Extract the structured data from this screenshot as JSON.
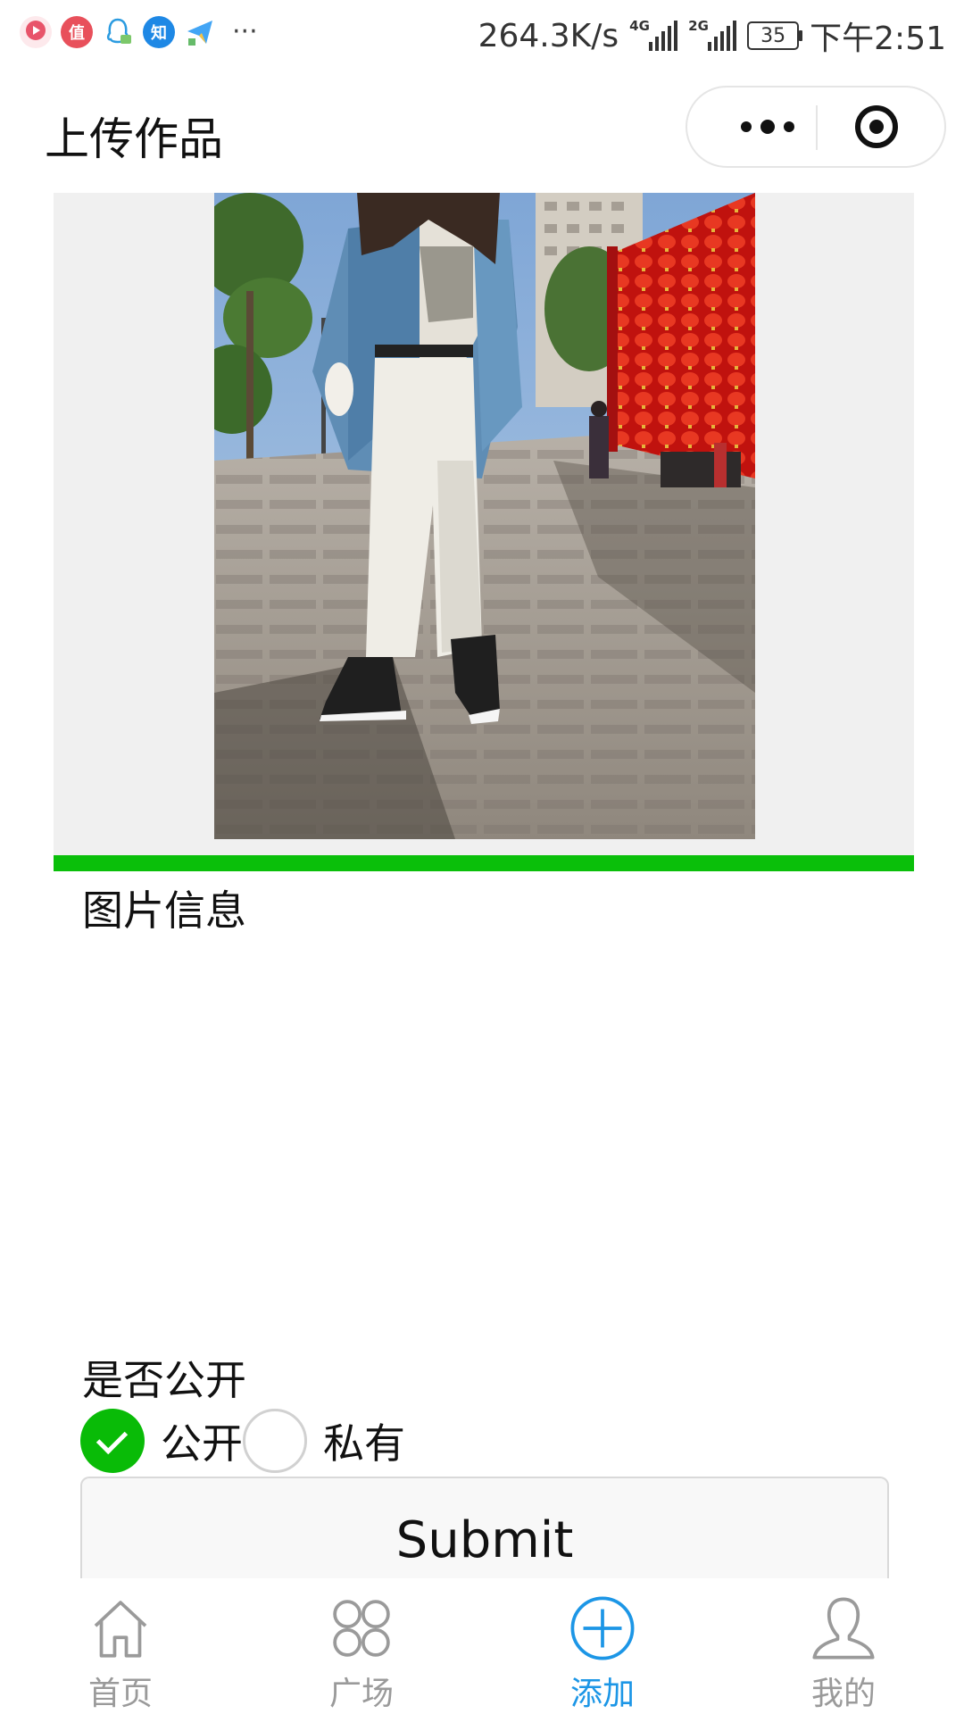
{
  "status_bar": {
    "net_speed": "264.3K/s",
    "signal1_tag": "4G",
    "signal2_tag": "2G",
    "battery": "35",
    "time": "下午2:51",
    "app_icons": [
      "video-app-icon",
      "zhi-app-icon",
      "qq-app-icon",
      "zhihu-icon",
      "send-app-icon"
    ],
    "zhihu_label": "知",
    "zhi_label": "值",
    "more": "···"
  },
  "nav": {
    "title": "上传作品"
  },
  "upload": {
    "progress": 1.0,
    "progress_color": "#0abf0a",
    "info_label": "图片信息",
    "public_label": "是否公开",
    "options": [
      {
        "label": "公开",
        "checked": true
      },
      {
        "label": "私有",
        "checked": false
      }
    ],
    "submit_label": "Submit"
  },
  "tabs": [
    {
      "label": "首页",
      "icon": "home-icon",
      "active": false
    },
    {
      "label": "广场",
      "icon": "grid-icon",
      "active": false
    },
    {
      "label": "添加",
      "icon": "add-circle-icon",
      "active": true
    },
    {
      "label": "我的",
      "icon": "user-icon",
      "active": false
    }
  ],
  "colors": {
    "active_tab": "#1c96e6",
    "inactive_tab": "#9a9a9a",
    "radio_checked": "#09bb07"
  }
}
